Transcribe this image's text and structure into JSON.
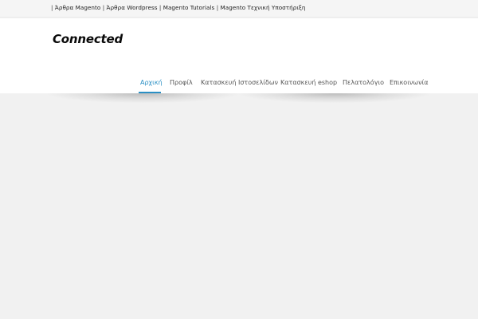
{
  "topbar": {
    "links": [
      {
        "prefix": "| ",
        "label": "Άρθρα Magento"
      },
      {
        "prefix": " | ",
        "label": "Άρθρα Wordpress"
      },
      {
        "prefix": " | ",
        "label": "Magento Tutorials"
      },
      {
        "prefix": " | ",
        "label": "Magento Τεχνική Υποστήριξη"
      }
    ]
  },
  "header": {
    "logo_text": "Connected"
  },
  "nav": {
    "items": [
      {
        "label": "Αρχική",
        "active": true
      },
      {
        "label": "Προφίλ",
        "active": false
      },
      {
        "label": "Κατασκευή Ιστοσελίδων",
        "active": false
      },
      {
        "label": "Κατασκευή eshop",
        "active": false
      },
      {
        "label": "Πελατολόγιο",
        "active": false
      },
      {
        "label": "Επικοινωνία",
        "active": false
      }
    ]
  },
  "colors": {
    "accent": "#2a8fc4",
    "background": "#f1f1f1",
    "header_bg": "#ffffff"
  }
}
